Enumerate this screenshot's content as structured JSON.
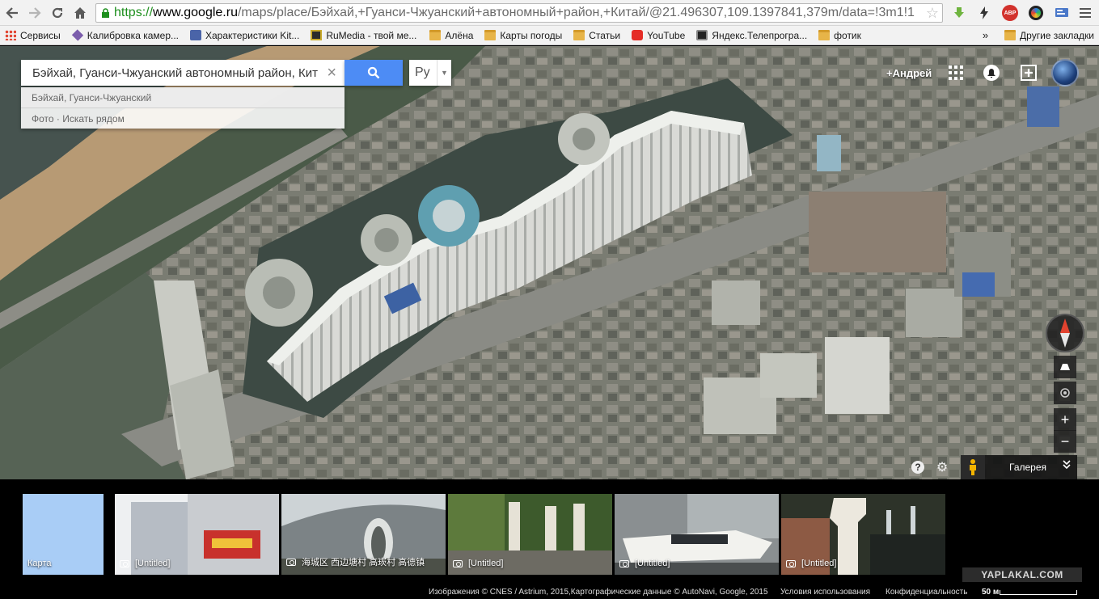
{
  "browser": {
    "url_scheme": "https://",
    "url_host": "www.google.ru",
    "url_path": "/maps/place/Бэйхай,+Гуанси-Чжуанский+автономный+район,+Китай/@21.496307,109.1397841,379m/data=!3m1!1",
    "extensions": [
      "download-icon",
      "lightning-icon",
      "adblock-icon",
      "camera-icon",
      "translate-icon"
    ],
    "adblock_label": "ABP"
  },
  "bookmarks": {
    "items": [
      {
        "label": "Сервисы",
        "icon": "apps-grid-icon"
      },
      {
        "label": "Калибровка камер...",
        "icon": "diamond-icon"
      },
      {
        "label": "Характеристики Kit...",
        "icon": "page-icon"
      },
      {
        "label": "RuMedia - твой ме...",
        "icon": "rumedia-icon"
      },
      {
        "label": "Алёна",
        "icon": "folder-icon"
      },
      {
        "label": "Карты погоды",
        "icon": "folder-icon"
      },
      {
        "label": "Статьи",
        "icon": "folder-icon"
      },
      {
        "label": "YouTube",
        "icon": "youtube-icon"
      },
      {
        "label": "Яндекс.Телепрогра...",
        "icon": "tv-icon"
      },
      {
        "label": "фотик",
        "icon": "folder-icon"
      }
    ],
    "overflow": "»",
    "other_label": "Другие закладки"
  },
  "maps": {
    "search_value": "Бэйхай, Гуанси-Чжуанский автономный район, Кит",
    "suggestions": [
      "Бэйхай, Гуанси-Чжуанский",
      "Фото · Искать рядом"
    ],
    "lang_label": "Ру",
    "user_link": "+Андрей",
    "gallery_label": "Галерея",
    "zoom_in": "+",
    "zoom_out": "−"
  },
  "filmstrip": [
    {
      "caption": "Карта",
      "type": "map"
    },
    {
      "caption": "[Untitled]",
      "type": "photo"
    },
    {
      "caption": "海城区 西边塘村 高崁村 高德镇",
      "type": "photo"
    },
    {
      "caption": "[Untitled]",
      "type": "photo"
    },
    {
      "caption": "[Untitled]",
      "type": "photo"
    },
    {
      "caption": "[Untitled]",
      "type": "photo"
    }
  ],
  "watermark": "YAPLAKAL.COM",
  "footer": {
    "attribution": "Изображения © CNES / Astrium, 2015,Картографические данные © AutoNavi, Google, 2015",
    "terms": "Условия использования",
    "privacy": "Конфиденциальность",
    "scale": "50 м"
  },
  "colors": {
    "search_blue": "#4d8cf5",
    "secure_green": "#1d8f1d",
    "youtube_red": "#e52d27"
  }
}
